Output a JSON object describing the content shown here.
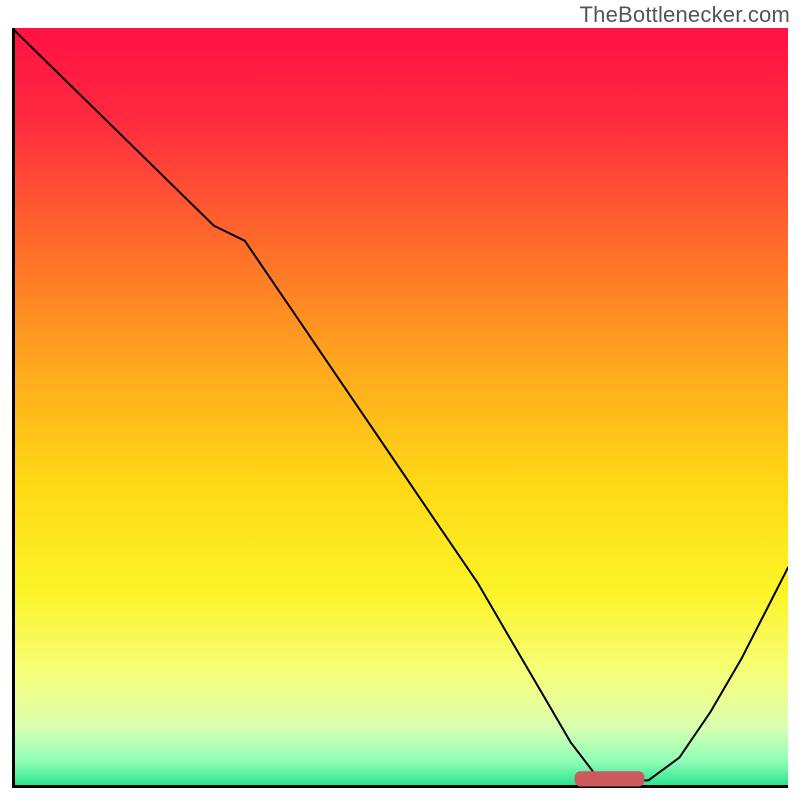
{
  "watermark": "TheBottlenecker.com",
  "chart_data": {
    "type": "line",
    "title": "",
    "xlabel": "",
    "ylabel": "",
    "xlim": [
      0,
      100
    ],
    "ylim": [
      0,
      100
    ],
    "grid": false,
    "legend": false,
    "background_gradient": {
      "stops": [
        {
          "offset": 0.0,
          "color": "#ff1144"
        },
        {
          "offset": 0.12,
          "color": "#ff2a3f"
        },
        {
          "offset": 0.28,
          "color": "#ff6a2b"
        },
        {
          "offset": 0.44,
          "color": "#ffa61e"
        },
        {
          "offset": 0.6,
          "color": "#ffd915"
        },
        {
          "offset": 0.74,
          "color": "#fcf427"
        },
        {
          "offset": 0.85,
          "color": "#f6ff7a"
        },
        {
          "offset": 0.92,
          "color": "#d9ffb0"
        },
        {
          "offset": 0.965,
          "color": "#8fffb8"
        },
        {
          "offset": 1.0,
          "color": "#1fe08a"
        }
      ]
    },
    "series": [
      {
        "name": "bottleneck-curve",
        "color": "#000000",
        "stroke_width": 2,
        "x": [
          0,
          6,
          12,
          18,
          22,
          26,
          30,
          36,
          42,
          48,
          54,
          60,
          64,
          68,
          72,
          75,
          78,
          82,
          86,
          90,
          94,
          98,
          100
        ],
        "y": [
          100,
          94,
          88,
          82,
          78,
          74,
          72,
          63,
          54,
          45,
          36,
          27,
          20,
          13,
          6,
          2,
          1,
          1,
          4,
          10,
          17,
          25,
          29
        ]
      }
    ],
    "marker": {
      "name": "optimal-range-marker",
      "shape": "rounded-rect",
      "color": "#cc5a5f",
      "x_center": 77,
      "y_center": 1.2,
      "width": 9,
      "height": 2.0
    },
    "axes": {
      "color": "#000000",
      "width": 3
    }
  }
}
